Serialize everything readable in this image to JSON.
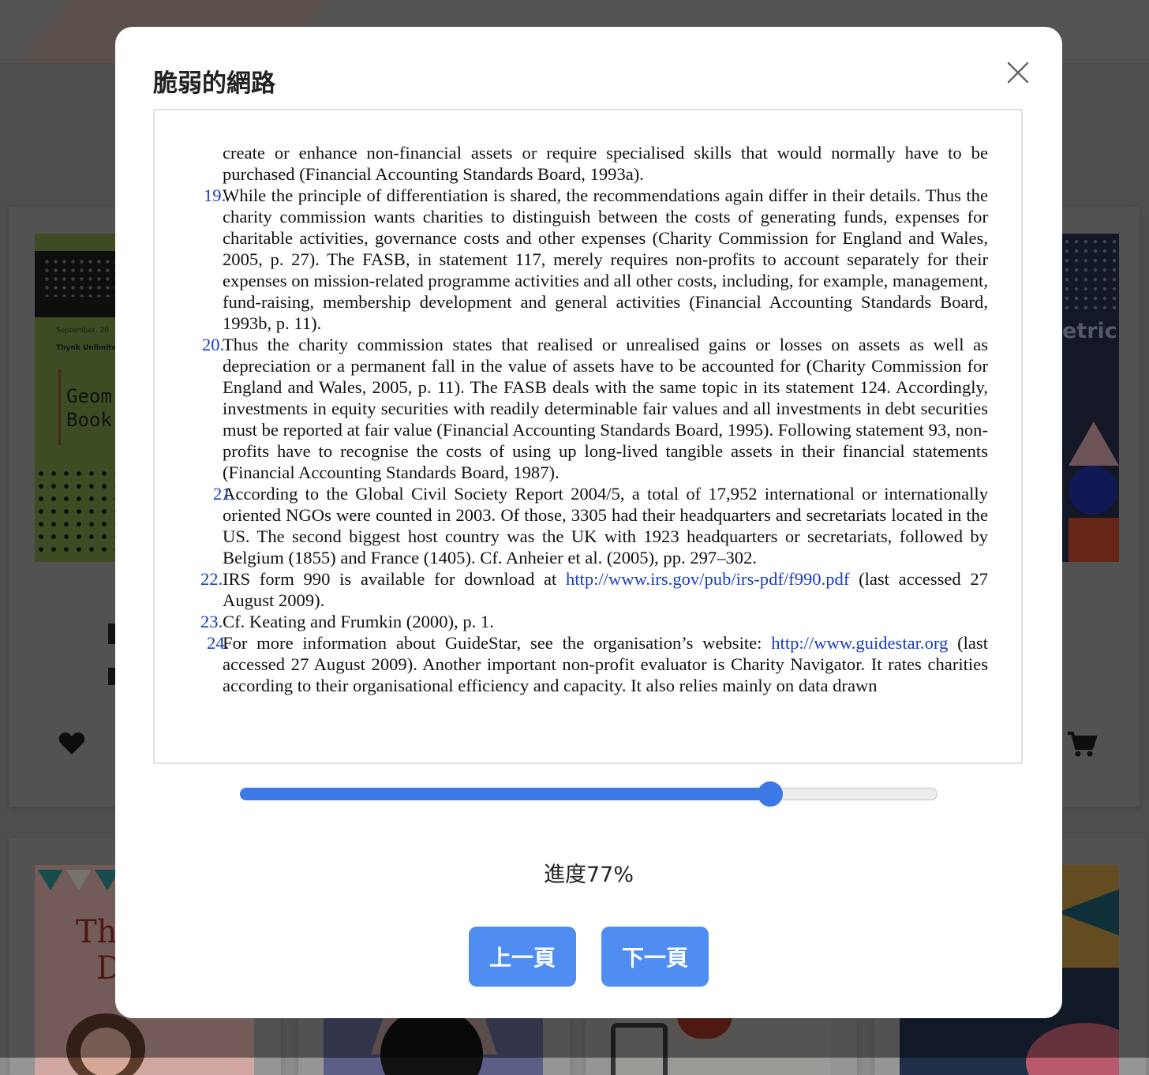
{
  "background": {
    "left_card": {
      "date": "September, 20",
      "publisher": "Thynk Unlimited",
      "title_line1": "Geom",
      "title_line2": "Book"
    },
    "right_card": {
      "title_fragment": "etric"
    },
    "bottom_left_card": {
      "title_line1": "Th",
      "title_line2": "D"
    },
    "heart_icon": "heart-icon",
    "cart_icon": "cart-icon"
  },
  "modal": {
    "title": "脆弱的網路",
    "page": {
      "intro": "create or enhance non-financial assets or require specialised skills that would normally have to be purchased (Financial Accounting Standards Board, 1993a).",
      "footnotes": [
        {
          "num": "19.",
          "text": "While the principle of differentiation is shared, the recommendations again differ in their details. Thus the charity commission wants charities to distinguish between the costs of generating funds, expenses for charitable activities, governance costs and other expenses (Charity Commission for England and Wales, 2005, p. 27). The FASB, in statement 117, merely requires non-profits to account separately for their expenses on mission-related programme activities and all other costs, including, for example, management, fund-raising, membership development and general activities (Financial Accounting Standards Board, 1993b, p. 11)."
        },
        {
          "num": "20.",
          "text": "Thus the charity commission states that realised or unrealised gains or losses on assets as well as depreciation or a permanent fall in the value of assets have to be accounted for (Charity Commission for England and Wales, 2005, p. 11). The FASB deals with the same topic in its statement 124. Accordingly, investments in equity securities with readily determinable fair values and all investments in debt securities must be reported at fair value (Financial Accounting Standards Board, 1995). Following statement 93, non-profits have to recognise the costs of using up long-lived tangible assets in their financial statements (Financial Accounting Standards Board, 1987)."
        },
        {
          "num": "21.",
          "text": "According to the Global Civil Society Report 2004/5, a total of 17,952 international or internationally oriented NGOs were counted in 2003. Of those, 3305 had their headquarters and secretariats located in the US. The second biggest host country was the UK with 1923 headquarters or secretariats, followed by Belgium (1855) and France (1405). Cf. Anheier et al. (2005), pp. 297–302."
        },
        {
          "num": "22.",
          "text_before": "IRS form 990 is available for download at ",
          "link": "http://www.irs.gov/pub/irs-pdf/f990.pdf",
          "text_after": " (last accessed 27 August 2009)."
        },
        {
          "num": "23.",
          "text": "Cf. Keating and Frumkin (2000), p. 1."
        },
        {
          "num": "24.",
          "text_before": "For more information about GuideStar, see the organisation’s website: ",
          "link": "http://www.guidestar.org",
          "text_after": " (last accessed 27 August 2009). Another important non-profit evaluator is Charity Navigator. It rates charities according to their organisational efficiency and capacity. It also relies mainly on data drawn"
        }
      ]
    },
    "slider_value": 0.76,
    "progress_label": "進度77%",
    "prev_button": "上一頁",
    "next_button": "下一頁",
    "close_icon": "close-icon",
    "accent_color": "#3c78e6",
    "button_color": "#4f8ef0"
  }
}
